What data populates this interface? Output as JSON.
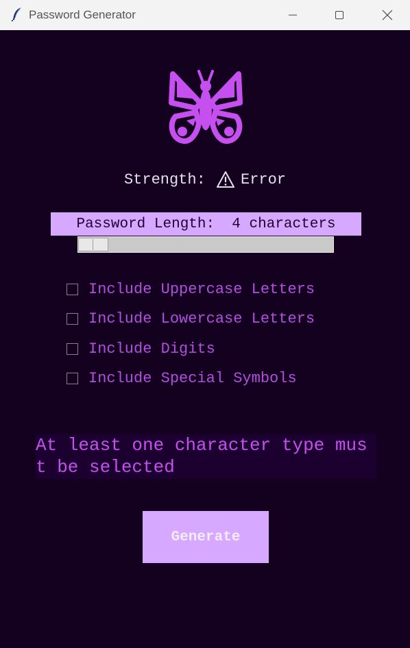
{
  "window": {
    "title": "Password Generator",
    "icons": {
      "app": "feather-icon",
      "minimize": "minimize-icon",
      "maximize": "maximize-icon",
      "close": "close-icon"
    }
  },
  "logo": {
    "icon": "butterfly-icon",
    "color": "#c64ff0"
  },
  "strength": {
    "label": "Strength: ",
    "icon": "warning-icon",
    "value": "Error"
  },
  "length": {
    "label": "Password Length:  4 characters",
    "value": 4,
    "min": 4,
    "max": 64
  },
  "options": [
    {
      "label": "Include Uppercase Letters",
      "checked": false
    },
    {
      "label": "Include Lowercase Letters",
      "checked": false
    },
    {
      "label": "Include Digits",
      "checked": false
    },
    {
      "label": "Include Special Symbols",
      "checked": false
    }
  ],
  "message": "At least one character type must be selected",
  "generate_label": "Generate",
  "colors": {
    "background": "#14001f",
    "accent": "#d6a8ff",
    "label_purple": "#b14fe0",
    "error_text": "#c64ff0"
  }
}
